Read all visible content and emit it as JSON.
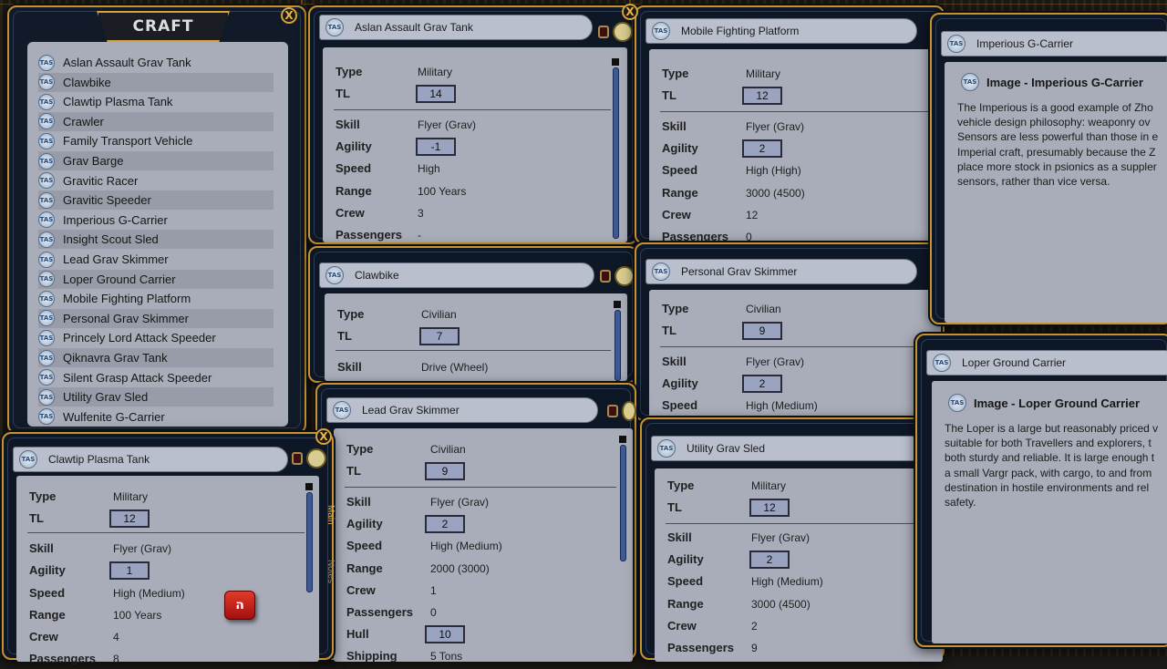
{
  "craft_panel": {
    "title": "CRAFT",
    "close": "X",
    "items": [
      "Aslan Assault Grav Tank",
      "Clawbike",
      "Clawtip Plasma Tank",
      "Crawler",
      "Family Transport Vehicle",
      "Grav Barge",
      "Gravitic Racer",
      "Gravitic Speeder",
      "Imperious G-Carrier",
      "Insight Scout Sled",
      "Lead Grav Skimmer",
      "Loper Ground Carrier",
      "Mobile Fighting Platform",
      "Personal Grav Skimmer",
      "Princely Lord Attack Speeder",
      "Qiknavra Grav Tank",
      "Silent Grasp Attack Speeder",
      "Utility Grav Sled",
      "Wulfenite G-Carrier"
    ]
  },
  "icon_text": "TAS",
  "labels": {
    "type": "Type",
    "tl": "TL",
    "skill": "Skill",
    "agility": "Agility",
    "speed": "Speed",
    "range": "Range",
    "crew": "Crew",
    "passengers": "Passengers",
    "hull": "Hull",
    "shipping": "Shipping"
  },
  "aslan": {
    "title": "Aslan Assault Grav Tank",
    "type": "Military",
    "tl": "14",
    "skill": "Flyer (Grav)",
    "agility": "-1",
    "speed": "High",
    "range": "100 Years",
    "crew": "3",
    "passengers": "-"
  },
  "mobile": {
    "title": "Mobile Fighting Platform",
    "type": "Military",
    "tl": "12",
    "skill": "Flyer (Grav)",
    "agility": "2",
    "speed": "High (High)",
    "range": "3000 (4500)",
    "crew": "12",
    "passengers": "0"
  },
  "clawbike": {
    "title": "Clawbike",
    "type": "Civilian",
    "tl": "7",
    "skill": "Drive (Wheel)"
  },
  "personal": {
    "title": "Personal Grav Skimmer",
    "type": "Civilian",
    "tl": "9",
    "skill": "Flyer (Grav)",
    "agility": "2",
    "speed": "High (Medium)"
  },
  "lead": {
    "title": "Lead Grav Skimmer",
    "type": "Civilian",
    "tl": "9",
    "skill": "Flyer (Grav)",
    "agility": "2",
    "speed": "High (Medium)",
    "range": "2000 (3000)",
    "crew": "1",
    "passengers": "0",
    "hull": "10",
    "shipping": "5 Tons"
  },
  "utility": {
    "title": "Utility Grav Sled",
    "type": "Military",
    "tl": "12",
    "skill": "Flyer (Grav)",
    "agility": "2",
    "speed": "High (Medium)",
    "range": "3000 (4500)",
    "crew": "2",
    "passengers": "9"
  },
  "clawtip": {
    "title": "Clawtip Plasma Tank",
    "type": "Military",
    "tl": "12",
    "skill": "Flyer (Grav)",
    "agility": "1",
    "speed": "High (Medium)",
    "range": "100 Years",
    "crew": "4",
    "passengers": "8",
    "tab_main": "Main",
    "tab_notes": "Notes",
    "dice_label": "ה"
  },
  "imperious": {
    "title": "Imperious G-Carrier",
    "image_label": "Image - Imperious G-Carrier",
    "description": "The Imperious is a good example of Zho\nvehicle design philosophy: weaponry ov\nSensors are less powerful than those in e\nImperial craft, presumably because the Z\nplace more stock in psionics as a suppler\nsensors, rather than vice versa."
  },
  "loper": {
    "title": "Loper Ground Carrier",
    "image_label": "Image - Loper Ground Carrier",
    "description": "The Loper is a large but reasonably priced v\nsuitable for both Travellers and explorers, t\nboth sturdy and reliable. It is large enough t\na small Vargr pack, with cargo, to and from\ndestination in hostile environments and rel\nsafety."
  }
}
